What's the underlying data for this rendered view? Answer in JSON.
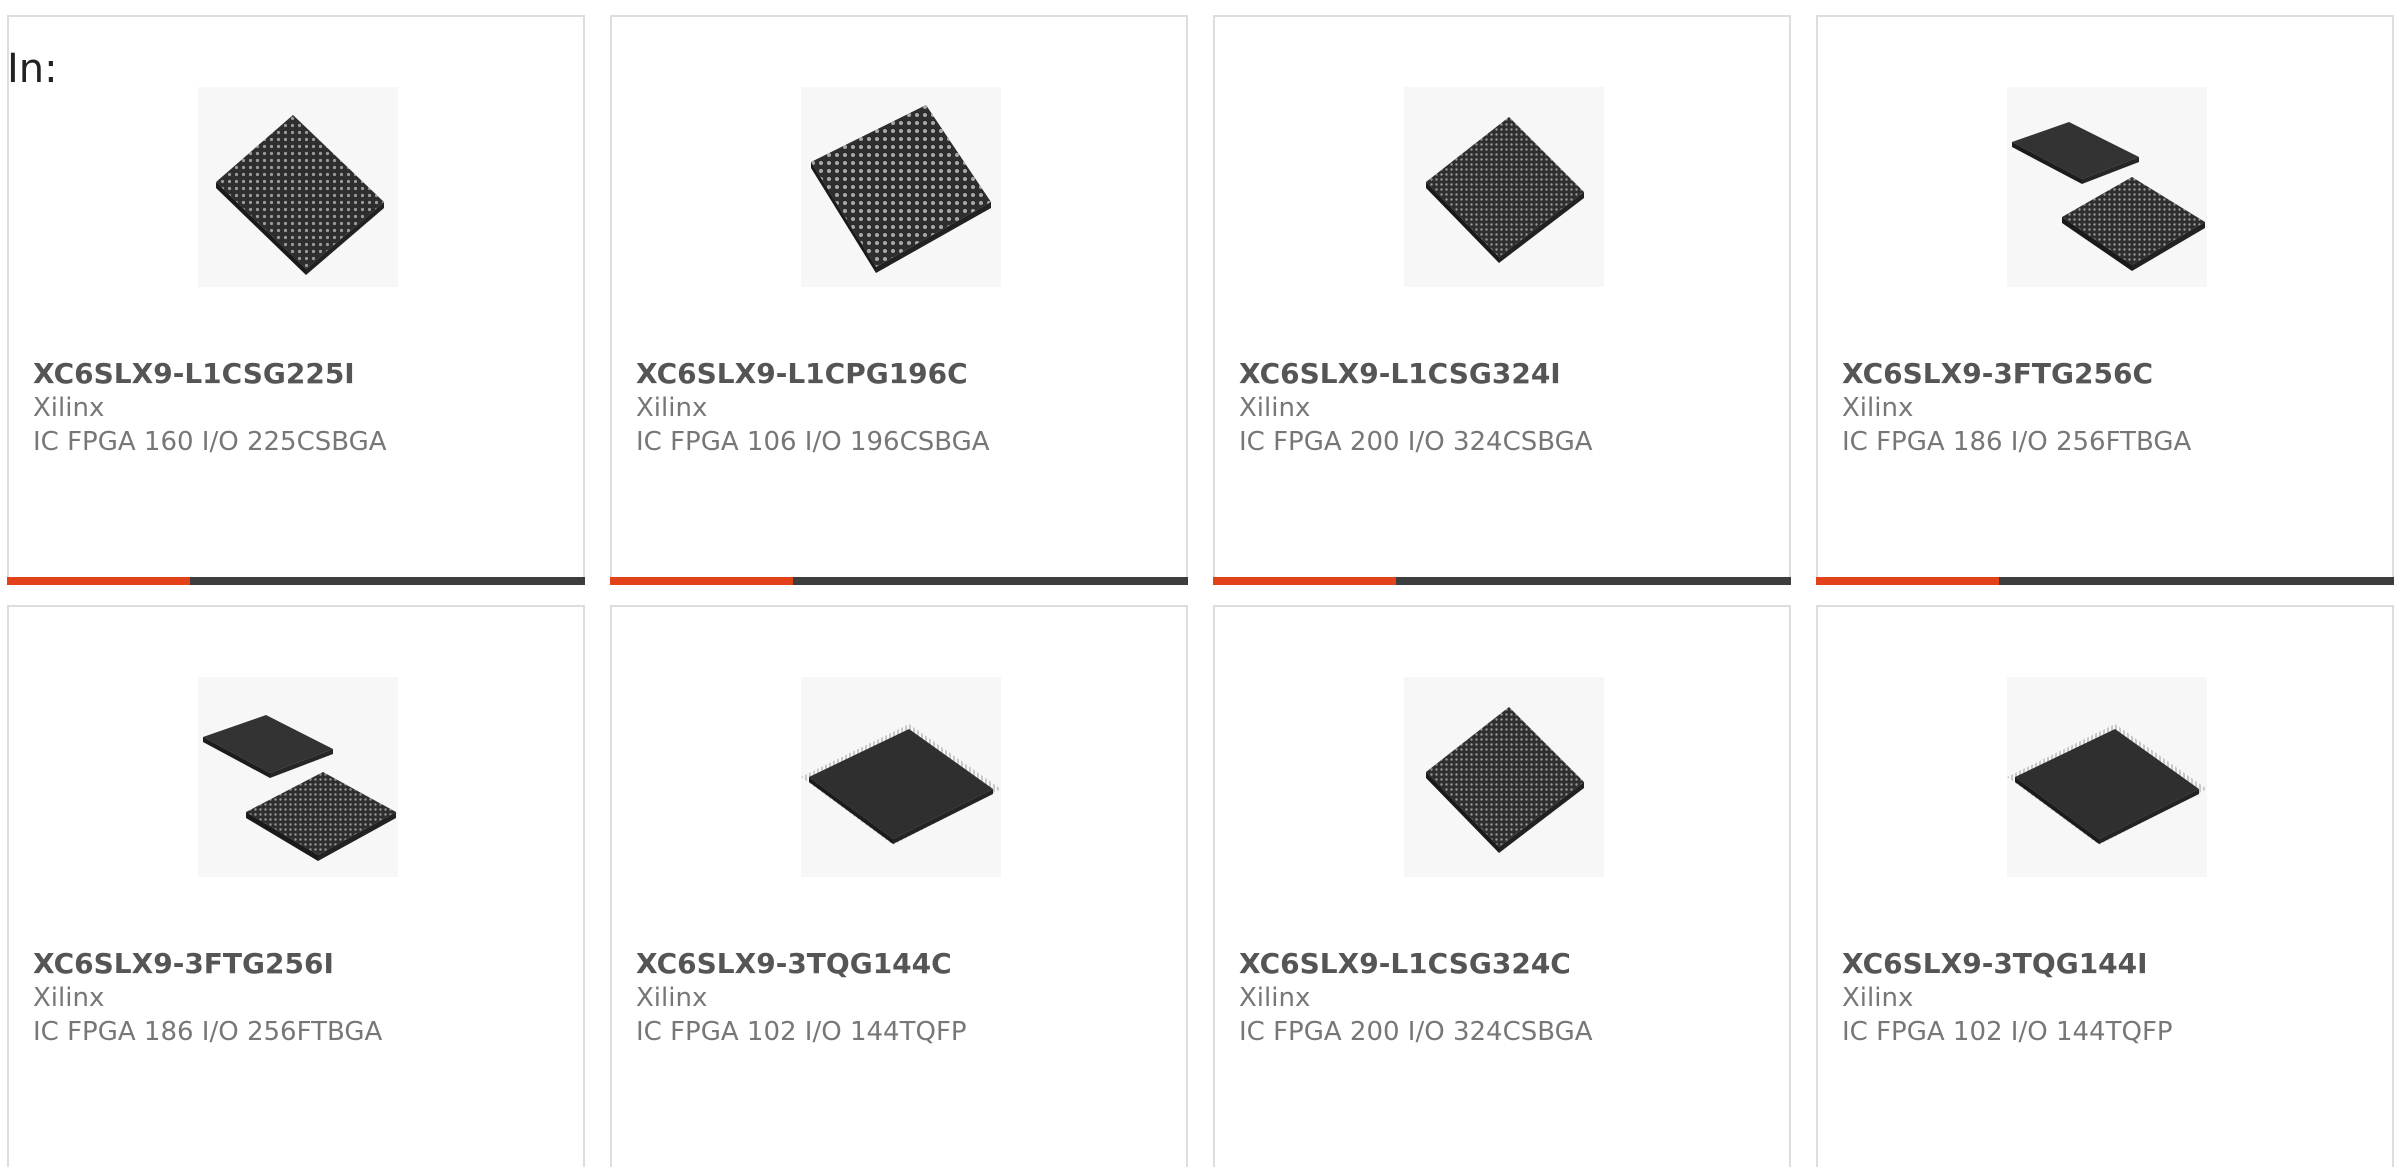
{
  "header": {
    "in_label": "In:"
  },
  "colors": {
    "accent": "#e2411a",
    "bar_dark": "#3d3d3d",
    "border": "#dddddd",
    "text_title": "#555555",
    "text_body": "#777777"
  },
  "products": [
    {
      "part": "XC6SLX9-L1CSG225I",
      "maker": "Xilinx",
      "desc": "IC FPGA 160 I/O 225CSBGA",
      "icon": "bga-chip-icon"
    },
    {
      "part": "XC6SLX9-L1CPG196C",
      "maker": "Xilinx",
      "desc": "IC FPGA 106 I/O 196CSBGA",
      "icon": "bga-chip-icon"
    },
    {
      "part": "XC6SLX9-L1CSG324I",
      "maker": "Xilinx",
      "desc": "IC FPGA 200 I/O 324CSBGA",
      "icon": "bga-chip-icon"
    },
    {
      "part": "XC6SLX9-3FTG256C",
      "maker": "Xilinx",
      "desc": "IC FPGA 186 I/O 256FTBGA",
      "icon": "bga-chip-pair-icon"
    },
    {
      "part": "XC6SLX9-3FTG256I",
      "maker": "Xilinx",
      "desc": "IC FPGA 186 I/O 256FTBGA",
      "icon": "bga-chip-pair-icon"
    },
    {
      "part": "XC6SLX9-3TQG144C",
      "maker": "Xilinx",
      "desc": "IC FPGA 102 I/O 144TQFP",
      "icon": "tqfp-chip-icon"
    },
    {
      "part": "XC6SLX9-L1CSG324C",
      "maker": "Xilinx",
      "desc": "IC FPGA 200 I/O 324CSBGA",
      "icon": "bga-chip-icon"
    },
    {
      "part": "XC6SLX9-3TQG144I",
      "maker": "Xilinx",
      "desc": "IC FPGA 102 I/O 144TQFP",
      "icon": "tqfp-chip-icon"
    }
  ]
}
